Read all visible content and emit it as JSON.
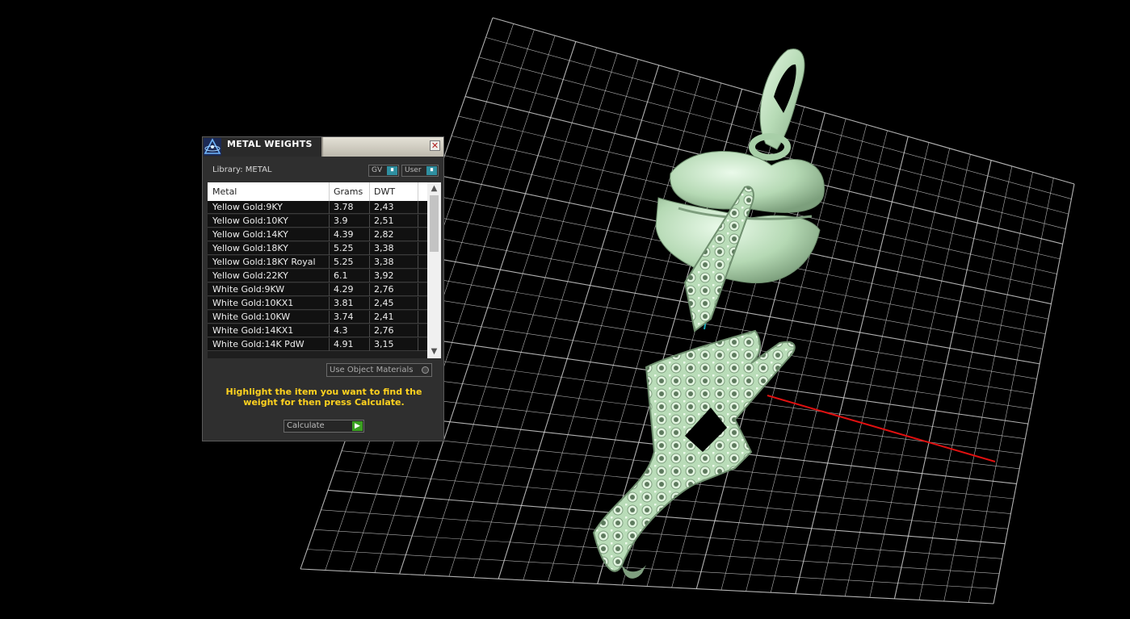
{
  "dialog": {
    "title": "METAL WEIGHTS",
    "close_symbol": "✕",
    "library_label": "Library: METAL",
    "toggles": [
      {
        "label": "GV",
        "icon": "toggle-icon"
      },
      {
        "label": "User",
        "icon": "toggle-icon"
      }
    ],
    "table": {
      "headers": [
        "Metal",
        "Grams",
        "DWT"
      ],
      "rows": [
        {
          "metal": "Yellow Gold:9KY",
          "grams": "3.78",
          "dwt": "2,43"
        },
        {
          "metal": "Yellow Gold:10KY",
          "grams": "3.9",
          "dwt": "2,51"
        },
        {
          "metal": "Yellow Gold:14KY",
          "grams": "4.39",
          "dwt": "2,82"
        },
        {
          "metal": "Yellow Gold:18KY",
          "grams": "5.25",
          "dwt": "3,38"
        },
        {
          "metal": "Yellow Gold:18KY Royal",
          "grams": "5.25",
          "dwt": "3,38"
        },
        {
          "metal": "Yellow Gold:22KY",
          "grams": "6.1",
          "dwt": "3,92"
        },
        {
          "metal": "White Gold:9KW",
          "grams": "4.29",
          "dwt": "2,76"
        },
        {
          "metal": "White Gold:10KX1",
          "grams": "3.81",
          "dwt": "2,45"
        },
        {
          "metal": "White Gold:10KW",
          "grams": "3.74",
          "dwt": "2,41"
        },
        {
          "metal": "White Gold:14KX1",
          "grams": "4.3",
          "dwt": "2,76"
        },
        {
          "metal": "White Gold:14K PdW",
          "grams": "4.91",
          "dwt": "3,15"
        }
      ]
    },
    "use_object_materials": "Use Object Materials",
    "hint": "Highlight the item you want to find the weight for then press Calculate.",
    "calculate_label": "Calculate"
  },
  "colors": {
    "model": "#bfe0bf",
    "grid": "#d0d0d0",
    "x_axis": "#e01010",
    "z_axis": "#18a8b8",
    "hint_text": "#ffd21f"
  }
}
